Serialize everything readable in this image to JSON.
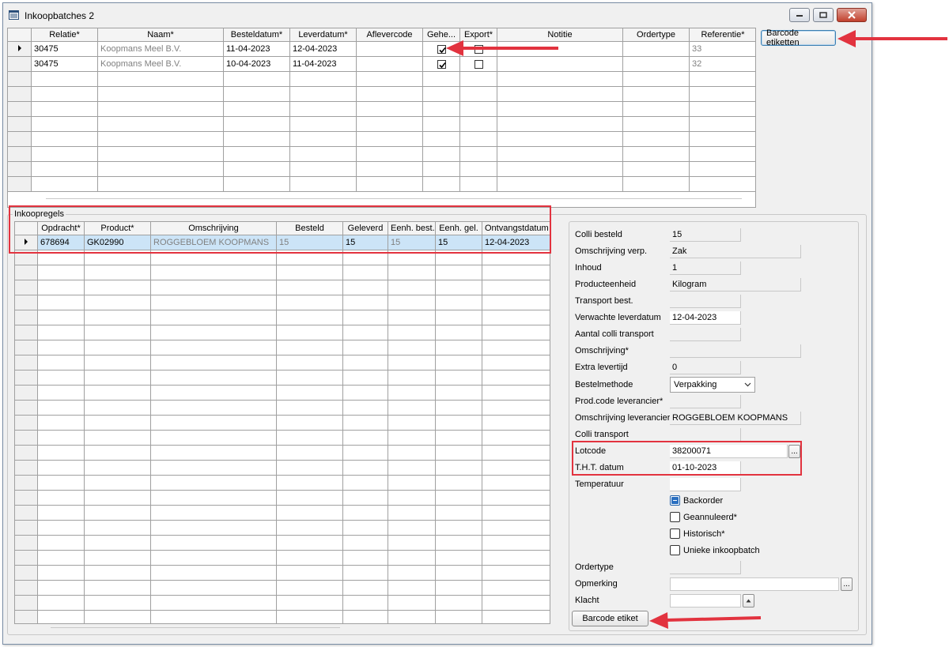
{
  "window": {
    "title": "Inkoopbatches 2"
  },
  "top_button": {
    "label": "Barcode etiketten"
  },
  "batches_grid": {
    "columns": [
      "Relatie*",
      "Naam*",
      "Besteldatum*",
      "Leverdatum*",
      "Aflevercode",
      "Gehe...",
      "Export*",
      "Notitie",
      "Ordertype",
      "Referentie*"
    ],
    "rows": [
      {
        "relatie": "30475",
        "naam": "Koopmans Meel B.V.",
        "besteldatum": "11-04-2023",
        "leverdatum": "12-04-2023",
        "aflevercode": "",
        "geheel": true,
        "export": false,
        "notitie": "",
        "ordertype": "",
        "referentie": "33",
        "current": true
      },
      {
        "relatie": "30475",
        "naam": "Koopmans Meel B.V.",
        "besteldatum": "10-04-2023",
        "leverdatum": "11-04-2023",
        "aflevercode": "",
        "geheel": true,
        "export": false,
        "notitie": "",
        "ordertype": "",
        "referentie": "32",
        "current": false
      }
    ]
  },
  "lines_group": {
    "title": "Inkoopregels",
    "columns": [
      "Opdracht*",
      "Product*",
      "Omschrijving",
      "Besteld",
      "Geleverd",
      "Eenh. best.",
      "Eenh. gel.",
      "Ontvangstdatum"
    ],
    "rows": [
      {
        "opdracht": "678694",
        "product": "GK02990",
        "omschrijving": "ROGGEBLOEM KOOPMANS",
        "besteld": "15",
        "geleverd": "15",
        "eenh_best": "15",
        "eenh_gel": "15",
        "ontvangstdatum": "12-04-2023"
      }
    ]
  },
  "details": {
    "colli_besteld": {
      "label": "Colli besteld",
      "value": "15"
    },
    "omschrijving_verp": {
      "label": "Omschrijving verp.",
      "value": "Zak"
    },
    "inhoud": {
      "label": "Inhoud",
      "value": "1"
    },
    "producteenheid": {
      "label": "Producteenheid",
      "value": "Kilogram"
    },
    "transport_best": {
      "label": "Transport best.",
      "value": ""
    },
    "verwachte_leverdatum": {
      "label": "Verwachte leverdatum",
      "value": "12-04-2023"
    },
    "aantal_colli_transport": {
      "label": "Aantal colli transport",
      "value": ""
    },
    "omschrijving": {
      "label": "Omschrijving*",
      "value": ""
    },
    "extra_levertijd": {
      "label": "Extra levertijd",
      "value": "0"
    },
    "bestelmethode": {
      "label": "Bestelmethode",
      "value": "Verpakking"
    },
    "prod_code_leverancier": {
      "label": "Prod.code leverancier*",
      "value": ""
    },
    "omschrijving_leverancier": {
      "label": "Omschrijving leverancier",
      "value": "ROGGEBLOEM KOOPMANS"
    },
    "colli_transport": {
      "label": "Colli transport",
      "value": ""
    },
    "lotcode": {
      "label": "Lotcode",
      "value": "38200071"
    },
    "tht_datum": {
      "label": "T.H.T. datum",
      "value": "01-10-2023"
    },
    "temperatuur": {
      "label": "Temperatuur",
      "value": ""
    },
    "checkboxes": {
      "backorder": {
        "label": "Backorder",
        "state": "indeterminate"
      },
      "geannuleerd": {
        "label": "Geannuleerd*",
        "state": "unchecked"
      },
      "historisch": {
        "label": "Historisch*",
        "state": "unchecked"
      },
      "unieke": {
        "label": "Unieke inkoopbatch",
        "state": "unchecked"
      }
    },
    "ordertype": {
      "label": "Ordertype",
      "value": ""
    },
    "opmerking": {
      "label": "Opmerking",
      "value": ""
    },
    "klacht": {
      "label": "Klacht",
      "value": ""
    },
    "ellipsis": "...",
    "barcode_button": "Barcode etiket"
  },
  "colors": {
    "highlight": "#e2333f",
    "selection": "#cce4f7"
  }
}
